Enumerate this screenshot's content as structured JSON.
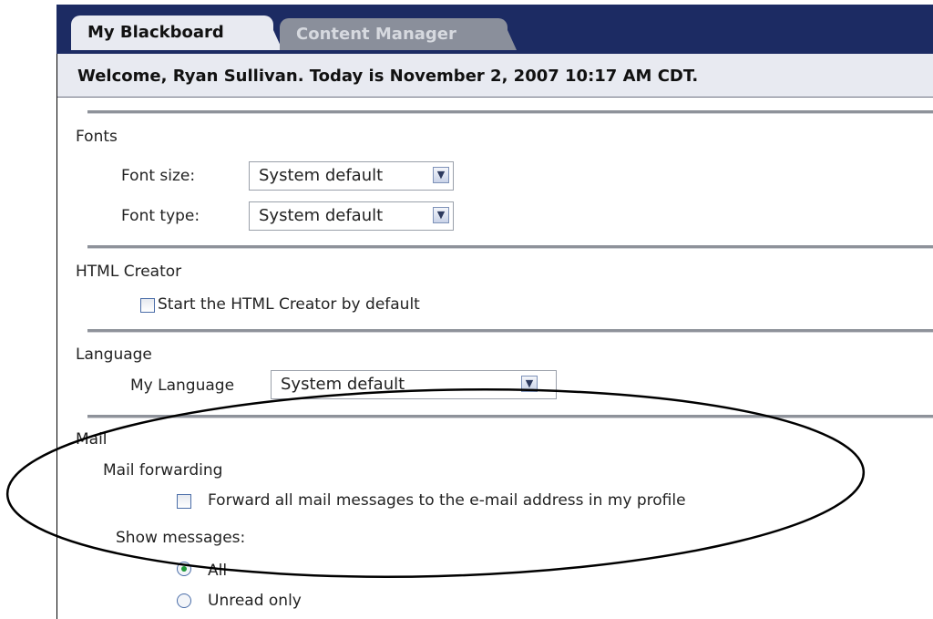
{
  "tabs": [
    {
      "label": "My Blackboard",
      "active": true
    },
    {
      "label": "Content Manager",
      "active": false
    }
  ],
  "welcome": "Welcome, Ryan Sullivan. Today is November 2, 2007 10:17 AM CDT.",
  "fonts": {
    "heading": "Fonts",
    "size_label": "Font size:",
    "size_value": "System default",
    "type_label": "Font type:",
    "type_value": "System default"
  },
  "html_creator": {
    "heading": "HTML Creator",
    "checkbox_label": "Start the HTML Creator by default",
    "checked": false
  },
  "language": {
    "heading": "Language",
    "label": "My Language",
    "value": "System default"
  },
  "mail": {
    "heading": "Mail",
    "forwarding_label": "Mail forwarding",
    "forward_checkbox_label": "Forward all mail messages to the e-mail address in my profile",
    "forward_checked": false,
    "show_messages_label": "Show messages:",
    "options": [
      {
        "label": "All",
        "selected": true
      },
      {
        "label": "Unread only",
        "selected": false
      }
    ]
  },
  "colors": {
    "tab_bar": "#1c2b63",
    "active_tab": "#e8eaf1",
    "inactive_tab": "#8a8f9b",
    "radio_selected": "#1f9a3a"
  },
  "icons": {
    "dropdown": "chevron-down-icon",
    "checkbox": "checkbox-icon",
    "radio": "radio-icon"
  }
}
